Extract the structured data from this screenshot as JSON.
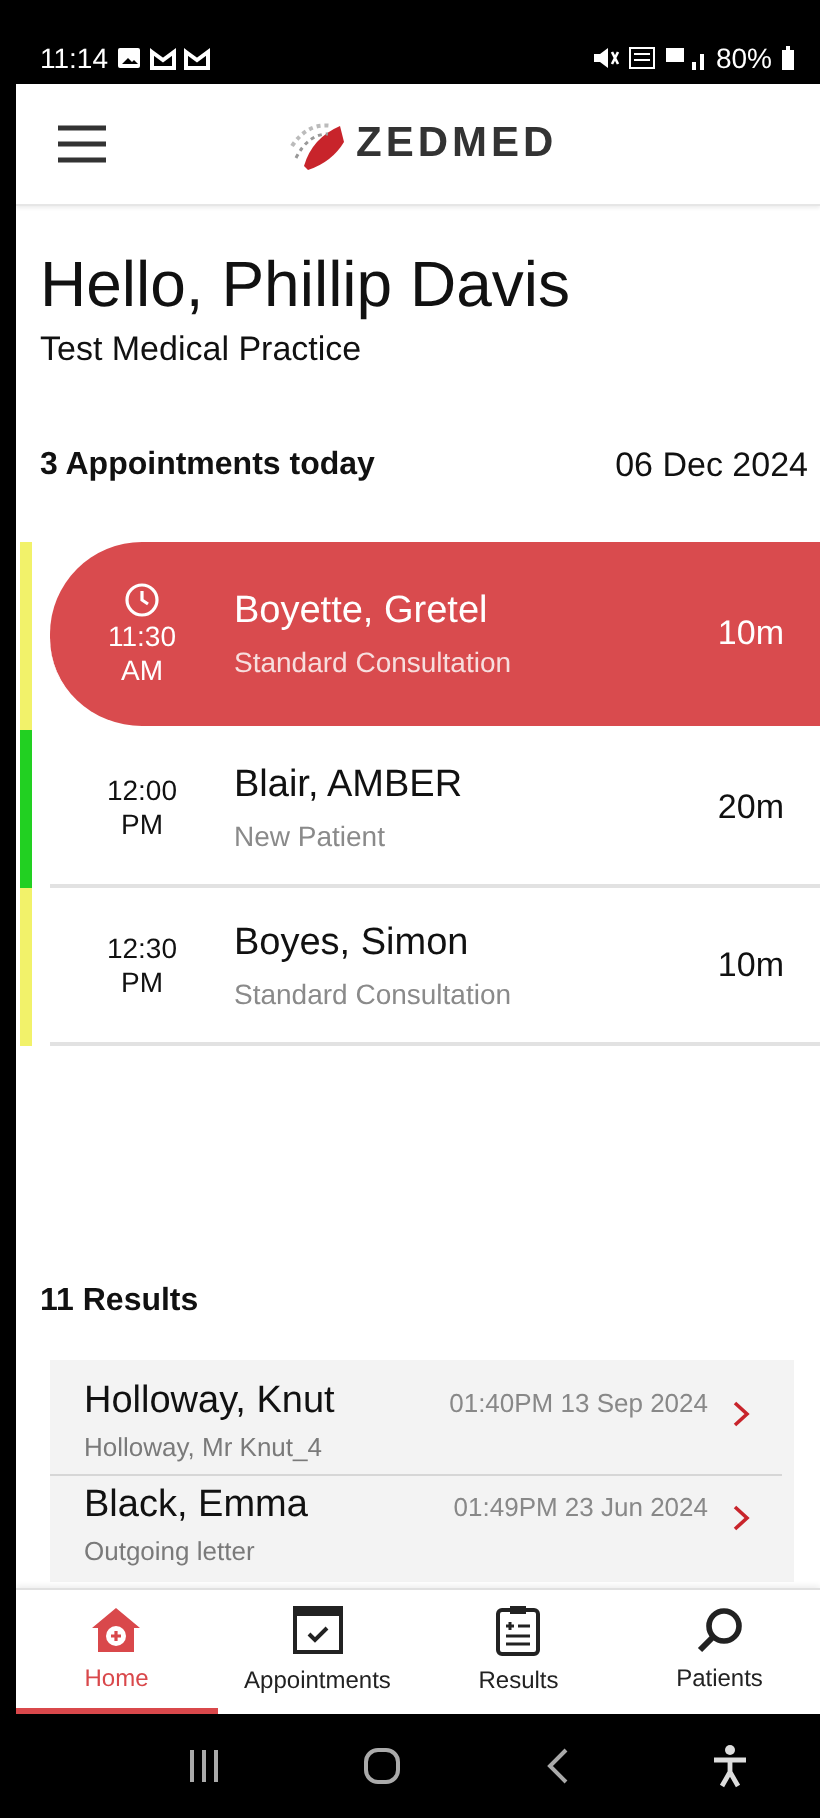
{
  "status_bar": {
    "time": "11:14",
    "battery": "80%"
  },
  "header": {
    "logo": "ZEDMED"
  },
  "greeting": {
    "title": "Hello, Phillip Davis",
    "subtitle": "Test Medical Practice"
  },
  "appointments": {
    "heading": "3 Appointments today",
    "date": "06 Dec 2024",
    "items": [
      {
        "time": "11:30",
        "period": "AM",
        "name": "Boyette, Gretel",
        "type": "Standard Consultation",
        "duration": "10m",
        "color": "#f2f26a",
        "selected": true
      },
      {
        "time": "12:00",
        "period": "PM",
        "name": "Blair, AMBER",
        "type": "New Patient",
        "duration": "20m",
        "color": "#22d022",
        "selected": false
      },
      {
        "time": "12:30",
        "period": "PM",
        "name": "Boyes, Simon",
        "type": "Standard Consultation",
        "duration": "10m",
        "color": "#f2f26a",
        "selected": false
      }
    ]
  },
  "results": {
    "heading": "11 Results",
    "items": [
      {
        "name": "Holloway, Knut",
        "detail": "Holloway, Mr Knut_4",
        "datetime": "01:40PM 13 Sep 2024"
      },
      {
        "name": "Black, Emma",
        "detail": "Outgoing letter",
        "datetime": "01:49PM 23 Jun 2024"
      }
    ]
  },
  "tabs": [
    {
      "kind": "home",
      "label": "Home",
      "selected": true
    },
    {
      "kind": "calendar",
      "label": "Appointments",
      "selected": false
    },
    {
      "kind": "clipboard",
      "label": "Results",
      "selected": false
    },
    {
      "kind": "search",
      "label": "Patients",
      "selected": false
    }
  ]
}
